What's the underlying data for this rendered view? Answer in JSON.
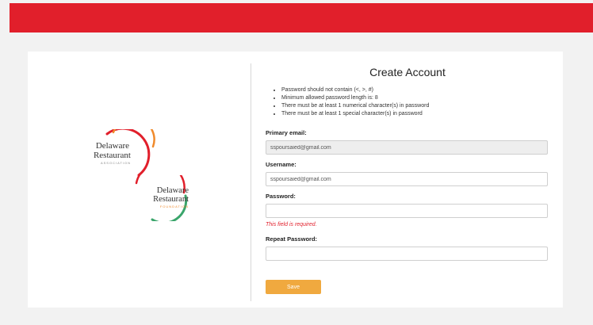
{
  "logos": {
    "association": {
      "line1": "Delaware",
      "line2": "Restaurant",
      "line3": "ASSOCIATION"
    },
    "foundation": {
      "line1": "Delaware",
      "line2": "Restaurant",
      "line3": "FOUNDATION"
    }
  },
  "form": {
    "title": "Create Account",
    "rules": [
      "Password should not contain (<, >, #)",
      "Minimum allowed password length is: 8",
      "There must be at least 1 numerical character(s) in password",
      "There must be at least 1 special character(s) in password"
    ],
    "primary_email": {
      "label": "Primary email:",
      "value": "sspoursaied@gmail.com"
    },
    "username": {
      "label": "Username:",
      "value": "sspoursaied@gmail.com"
    },
    "password": {
      "label": "Password:",
      "value": "",
      "error": "This field is required."
    },
    "repeat_password": {
      "label": "Repeat Password:",
      "value": ""
    },
    "save_label": "Save"
  },
  "colors": {
    "brand_red": "#e11f2b",
    "save_button": "#f0a93f",
    "logo_orange": "#f08a2c",
    "logo_green": "#3aa56b"
  }
}
